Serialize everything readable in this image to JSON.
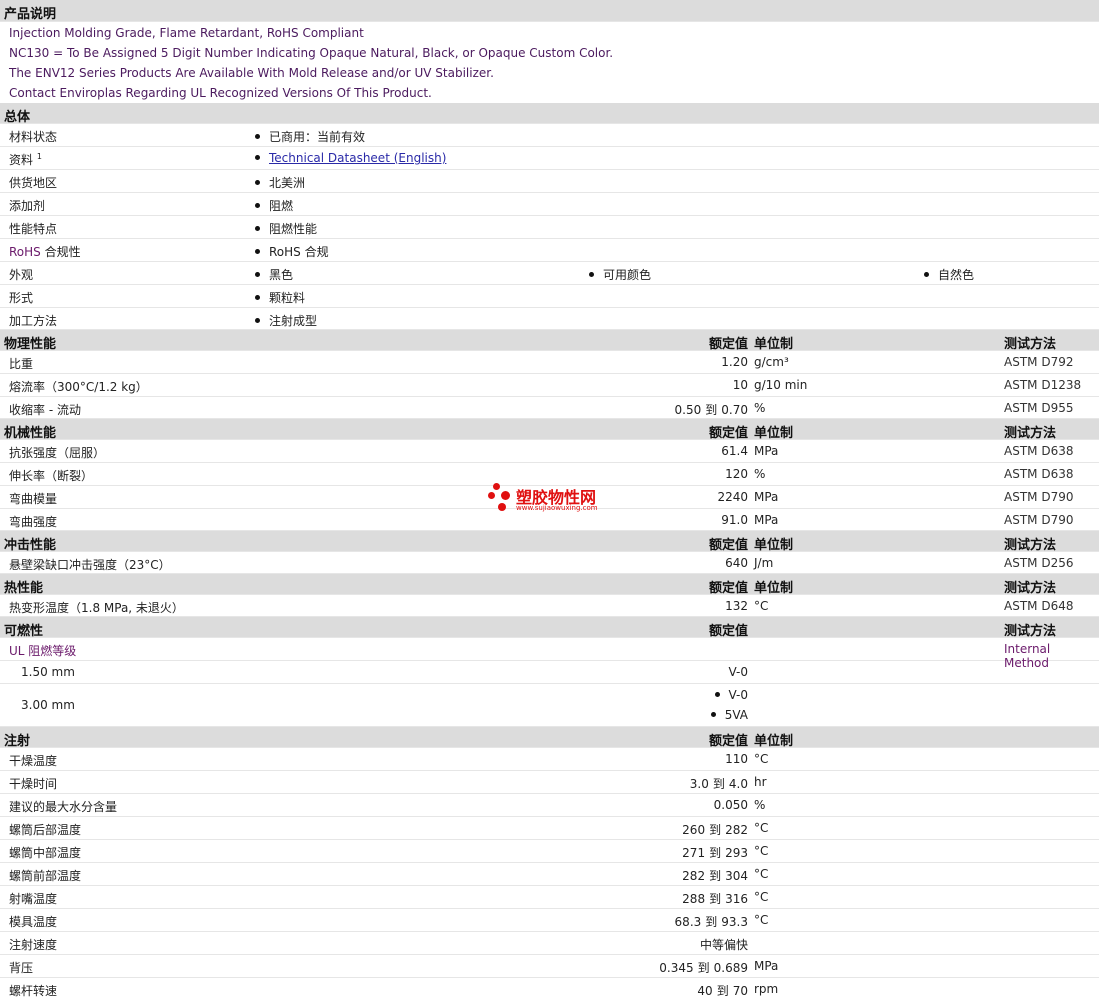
{
  "sections": {
    "desc": "产品说明",
    "general": "总体",
    "physical": "物理性能",
    "mechanical": "机械性能",
    "impact": "冲击性能",
    "thermal": "热性能",
    "flammability": "可燃性",
    "injection": "注射"
  },
  "cols": {
    "nominal": "额定值",
    "unit": "单位制",
    "method": "测试方法"
  },
  "description": [
    "Injection Molding Grade, Flame Retardant, RoHS Compliant",
    "NC130 = To Be Assigned 5 Digit Number Indicating Opaque Natural, Black, or Opaque Custom Color.",
    "The ENV12 Series Products Are Available With Mold Release and/or UV Stabilizer.",
    "Contact Enviroplas Regarding UL Recognized Versions Of This Product."
  ],
  "general": {
    "status_label": "材料状态",
    "status_value": "已商用：当前有效",
    "docs_label": "资料",
    "docs_sup": "1",
    "docs_value": "Technical Datasheet (English)",
    "region_label": "供货地区",
    "region_value": "北美洲",
    "additive_label": "添加剂",
    "additive_value": "阻燃",
    "feature_label": "性能特点",
    "feature_value": "阻燃性能",
    "rohs_label_a": "RoHS",
    "rohs_label_b": " 合规性",
    "rohs_value": "RoHS 合规",
    "appearance_label": "外观",
    "appearance_values": [
      "黑色",
      "可用颜色",
      "自然色"
    ],
    "form_label": "形式",
    "form_value": "颗粒料",
    "process_label": "加工方法",
    "process_value": "注射成型"
  },
  "physical": [
    {
      "label": "比重",
      "value": "1.20",
      "unit": "g/cm³",
      "method": "ASTM D792"
    },
    {
      "label": "熔流率（300°C/1.2 kg）",
      "value": "10",
      "unit": "g/10 min",
      "method": "ASTM D1238"
    },
    {
      "label": "收缩率 - 流动",
      "value_from": "0.50",
      "to": "到",
      "value_to": "0.70",
      "unit": "%",
      "method": "ASTM D955"
    }
  ],
  "mechanical": [
    {
      "label": "抗张强度（屈服）",
      "value": "61.4",
      "unit": "MPa",
      "method": "ASTM D638"
    },
    {
      "label": "伸长率（断裂）",
      "value": "120",
      "unit": "%",
      "method": "ASTM D638"
    },
    {
      "label": "弯曲模量",
      "value": "2240",
      "unit": "MPa",
      "method": "ASTM D790"
    },
    {
      "label": "弯曲强度",
      "value": "91.0",
      "unit": "MPa",
      "method": "ASTM D790"
    }
  ],
  "impact": [
    {
      "label": "悬壁梁缺口冲击强度（23°C）",
      "value": "640",
      "unit": "J/m",
      "method": "ASTM D256"
    }
  ],
  "thermal": [
    {
      "label": "热变形温度（1.8 MPa, 未退火）",
      "value": "132",
      "unit": "°C",
      "method": "ASTM D648"
    }
  ],
  "flammability": {
    "ul_label": "UL 阻燃等级",
    "ul_method": "Internal Method",
    "t1_label": "1.50 mm",
    "t1_value": "V-0",
    "t2_label": "3.00 mm",
    "t2_values": [
      "V-0",
      "5VA"
    ]
  },
  "injection": [
    {
      "label": "干燥温度",
      "value": "110",
      "unit": "°C"
    },
    {
      "label": "干燥时间",
      "value_from": "3.0",
      "to": "到",
      "value_to": "4.0",
      "unit": "hr"
    },
    {
      "label": "建议的最大水分含量",
      "value": "0.050",
      "unit": "%"
    },
    {
      "label": "螺筒后部温度",
      "value_from": "260",
      "to": "到",
      "value_to": "282",
      "unit": "°C"
    },
    {
      "label": "螺筒中部温度",
      "value_from": "271",
      "to": "到",
      "value_to": "293",
      "unit": "°C"
    },
    {
      "label": "螺筒前部温度",
      "value_from": "282",
      "to": "到",
      "value_to": "304",
      "unit": "°C"
    },
    {
      "label": "射嘴温度",
      "value_from": "288",
      "to": "到",
      "value_to": "316",
      "unit": "°C"
    },
    {
      "label": "模具温度",
      "value_from": "68.3",
      "to": "到",
      "value_to": "93.3",
      "unit": "°C"
    },
    {
      "label": "注射速度",
      "value": "中等偏快",
      "unit": ""
    },
    {
      "label": "背压",
      "value_from": "0.345",
      "to": "到",
      "value_to": "0.689",
      "unit": "MPa"
    },
    {
      "label": "螺杆转速",
      "value_from": "40",
      "to": "到",
      "value_to": "70",
      "unit": "rpm"
    }
  ],
  "watermark": {
    "text": "塑胶物性网",
    "url": "www.sujiaowuxing.com",
    "color": "#e01010"
  }
}
